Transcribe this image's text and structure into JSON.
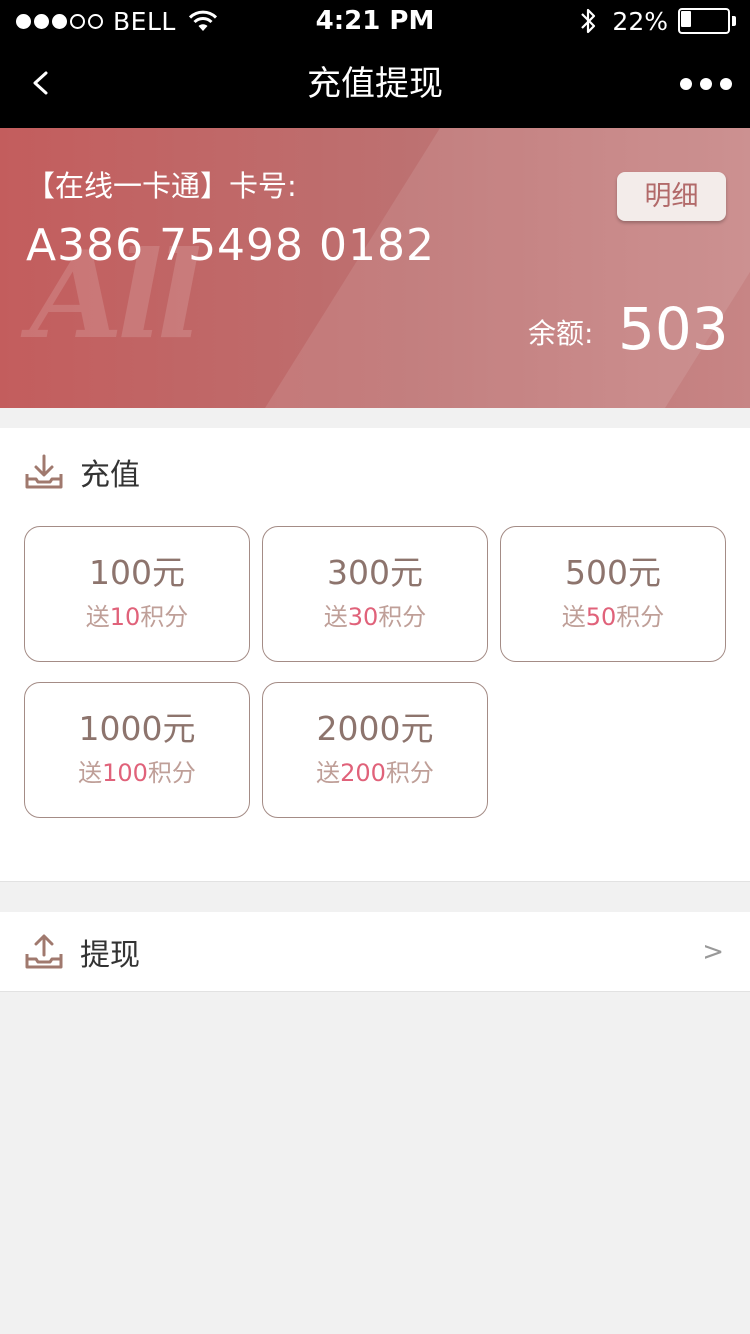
{
  "status_bar": {
    "carrier": "BELL",
    "time": "4:21 PM",
    "battery": "22%",
    "battery_level": 0.22
  },
  "nav": {
    "back": "<",
    "title": "充值提现"
  },
  "card": {
    "label": "【在线一卡通】卡号:",
    "number": "A386 75498 0182",
    "watermark": "All",
    "detail_button": "明细",
    "balance_label": "余额:",
    "balance_value": "503"
  },
  "recharge": {
    "title": "充值",
    "options": [
      {
        "amount": "100元",
        "bonus_prefix": "送",
        "bonus_points": "10",
        "bonus_suffix": "积分"
      },
      {
        "amount": "300元",
        "bonus_prefix": "送",
        "bonus_points": "30",
        "bonus_suffix": "积分"
      },
      {
        "amount": "500元",
        "bonus_prefix": "送",
        "bonus_points": "50",
        "bonus_suffix": "积分"
      },
      {
        "amount": "1000元",
        "bonus_prefix": "送",
        "bonus_points": "100",
        "bonus_suffix": "积分"
      },
      {
        "amount": "2000元",
        "bonus_prefix": "送",
        "bonus_points": "200",
        "bonus_suffix": "积分"
      }
    ]
  },
  "withdraw": {
    "title": "提现",
    "chevron": ">"
  },
  "icons": {
    "download": "download-tray-icon",
    "upload": "upload-tray-icon"
  },
  "colors": {
    "card_start": "#c35d5d",
    "card_end": "#c78585",
    "accent_points": "#e0627a",
    "option_border": "#a48c86",
    "option_text": "#8d746d",
    "icon_brown": "#a0796e"
  }
}
